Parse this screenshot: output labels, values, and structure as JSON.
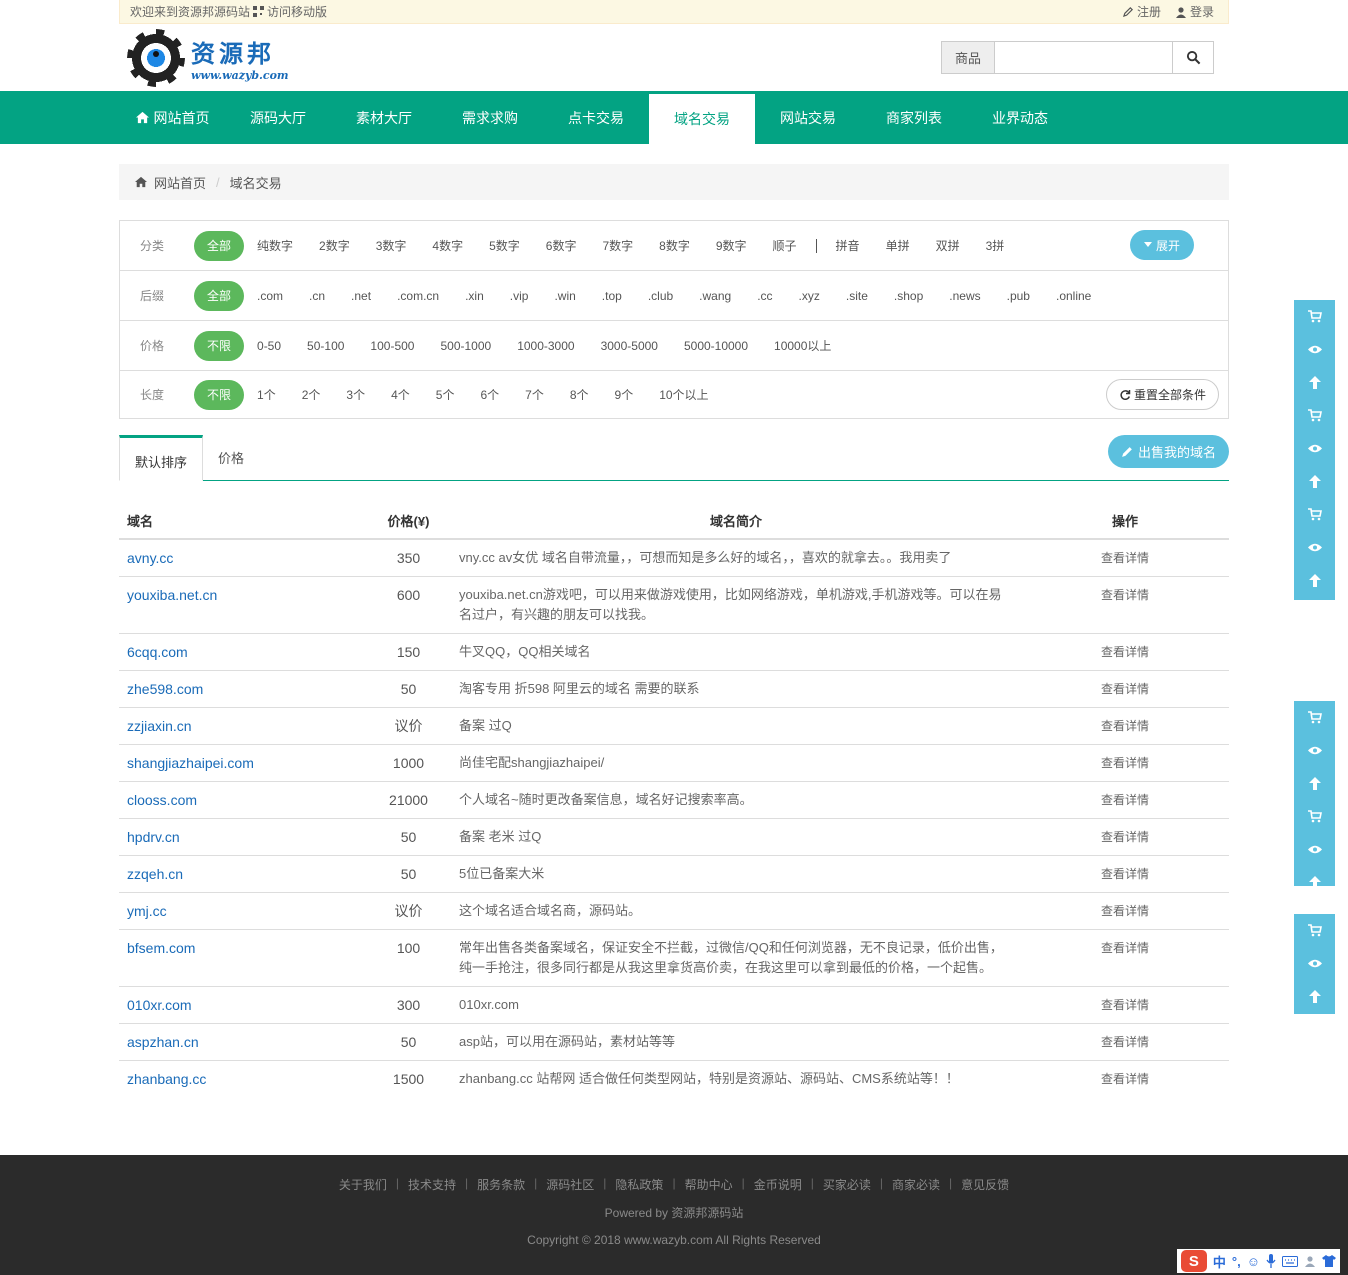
{
  "topbar": {
    "welcome": "欢迎来到资源邦源码站",
    "mobile": "访问移动版",
    "register": "注册",
    "login": "登录"
  },
  "logo": {
    "name": "资源邦",
    "url": "www.wazyb.com"
  },
  "search": {
    "category": "商品",
    "placeholder": ""
  },
  "nav": [
    {
      "label": "网站首页"
    },
    {
      "label": "源码大厅"
    },
    {
      "label": "素材大厅"
    },
    {
      "label": "需求求购"
    },
    {
      "label": "点卡交易"
    },
    {
      "label": "域名交易"
    },
    {
      "label": "网站交易"
    },
    {
      "label": "商家列表"
    },
    {
      "label": "业界动态"
    }
  ],
  "breadcrumb": {
    "home": "网站首页",
    "current": "域名交易"
  },
  "filters": {
    "category": {
      "label": "分类",
      "options": [
        "全部",
        "纯数字",
        "2数字",
        "3数字",
        "4数字",
        "5数字",
        "6数字",
        "7数字",
        "8数字",
        "9数字",
        "顺子"
      ],
      "options2": [
        "拼音",
        "单拼",
        "双拼",
        "3拼"
      ],
      "expand": "展开"
    },
    "suffix": {
      "label": "后缀",
      "options": [
        "全部",
        ".com",
        ".cn",
        ".net",
        ".com.cn",
        ".xin",
        ".vip",
        ".win",
        ".top",
        ".club",
        ".wang",
        ".cc",
        ".xyz",
        ".site",
        ".shop",
        ".news",
        ".pub",
        ".online"
      ]
    },
    "price": {
      "label": "价格",
      "options": [
        "不限",
        "0-50",
        "50-100",
        "100-500",
        "500-1000",
        "1000-3000",
        "3000-5000",
        "5000-10000",
        "10000以上"
      ]
    },
    "length": {
      "label": "长度",
      "options": [
        "不限",
        "1个",
        "2个",
        "3个",
        "4个",
        "5个",
        "6个",
        "7个",
        "8个",
        "9个",
        "10个以上"
      ],
      "reset": "重置全部条件"
    }
  },
  "tabs": {
    "default": "默认排序",
    "price": "价格",
    "sell": "出售我的域名"
  },
  "table": {
    "headers": {
      "domain": "域名",
      "price": "价格(¥)",
      "intro": "域名简介",
      "op": "操作"
    },
    "rows": [
      {
        "domain": "avny.cc",
        "price": "350",
        "intro": "vny.cc av女优 域名自带流量，，可想而知是多么好的域名，，喜欢的就拿去。。我用卖了",
        "op": "查看详情"
      },
      {
        "domain": "youxiba.net.cn",
        "price": "600",
        "intro": "youxiba.net.cn游戏吧，可以用来做游戏使用，比如网络游戏，单机游戏,手机游戏等。可以在易名过户，有兴趣的朋友可以找我。",
        "op": "查看详情"
      },
      {
        "domain": "6cqq.com",
        "price": "150",
        "intro": "牛叉QQ，QQ相关域名",
        "op": "查看详情"
      },
      {
        "domain": "zhe598.com",
        "price": "50",
        "intro": "淘客专用 折598 阿里云的域名 需要的联系",
        "op": "查看详情"
      },
      {
        "domain": "zzjiaxin.cn",
        "price": "议价",
        "intro": "备案 过Q",
        "op": "查看详情"
      },
      {
        "domain": "shangjiazhaipei.com",
        "price": "1000",
        "intro": "尚佳宅配shangjiazhaipei/",
        "op": "查看详情"
      },
      {
        "domain": "clooss.com",
        "price": "21000",
        "intro": "个人域名~随时更改备案信息，域名好记搜索率高。",
        "op": "查看详情"
      },
      {
        "domain": "hpdrv.cn",
        "price": "50",
        "intro": "备案 老米 过Q",
        "op": "查看详情"
      },
      {
        "domain": "zzqeh.cn",
        "price": "50",
        "intro": "5位已备案大米",
        "op": "查看详情"
      },
      {
        "domain": "ymj.cc",
        "price": "议价",
        "intro": "这个域名适合域名商，源码站。",
        "op": "查看详情"
      },
      {
        "domain": "bfsem.com",
        "price": "100",
        "intro": "常年出售各类备案域名，保证安全不拦截，过微信/QQ和任何浏览器，无不良记录，低价出售，纯一手抢注，很多同行都是从我这里拿货高价卖，在我这里可以拿到最低的价格，一个起售。",
        "op": "查看详情"
      },
      {
        "domain": "010xr.com",
        "price": "300",
        "intro": "010xr.com",
        "op": "查看详情"
      },
      {
        "domain": "aspzhan.cn",
        "price": "50",
        "intro": "asp站，可以用在源码站，素材站等等",
        "op": "查看详情"
      },
      {
        "domain": "zhanbang.cc",
        "price": "1500",
        "intro": "zhanbang.cc 站帮网 适合做任何类型网站，特别是资源站、源码站、CMS系统站等！！",
        "op": "查看详情"
      }
    ]
  },
  "footer": {
    "links": [
      "关于我们",
      "技术支持",
      "服务条款",
      "源码社区",
      "隐私政策",
      "帮助中心",
      "金币说明",
      "买家必读",
      "商家必读",
      "意见反馈"
    ],
    "powered": "Powered by 资源邦源码站",
    "copyright": "Copyright © 2018 www.wazyb.com All Rights Reserved"
  },
  "ime": {
    "chinese": "中"
  },
  "colors": {
    "primary": "#03a383",
    "info": "#5bc0de",
    "success": "#5cb85c",
    "link": "#1a6bb8",
    "footer": "#2b2b2b"
  }
}
